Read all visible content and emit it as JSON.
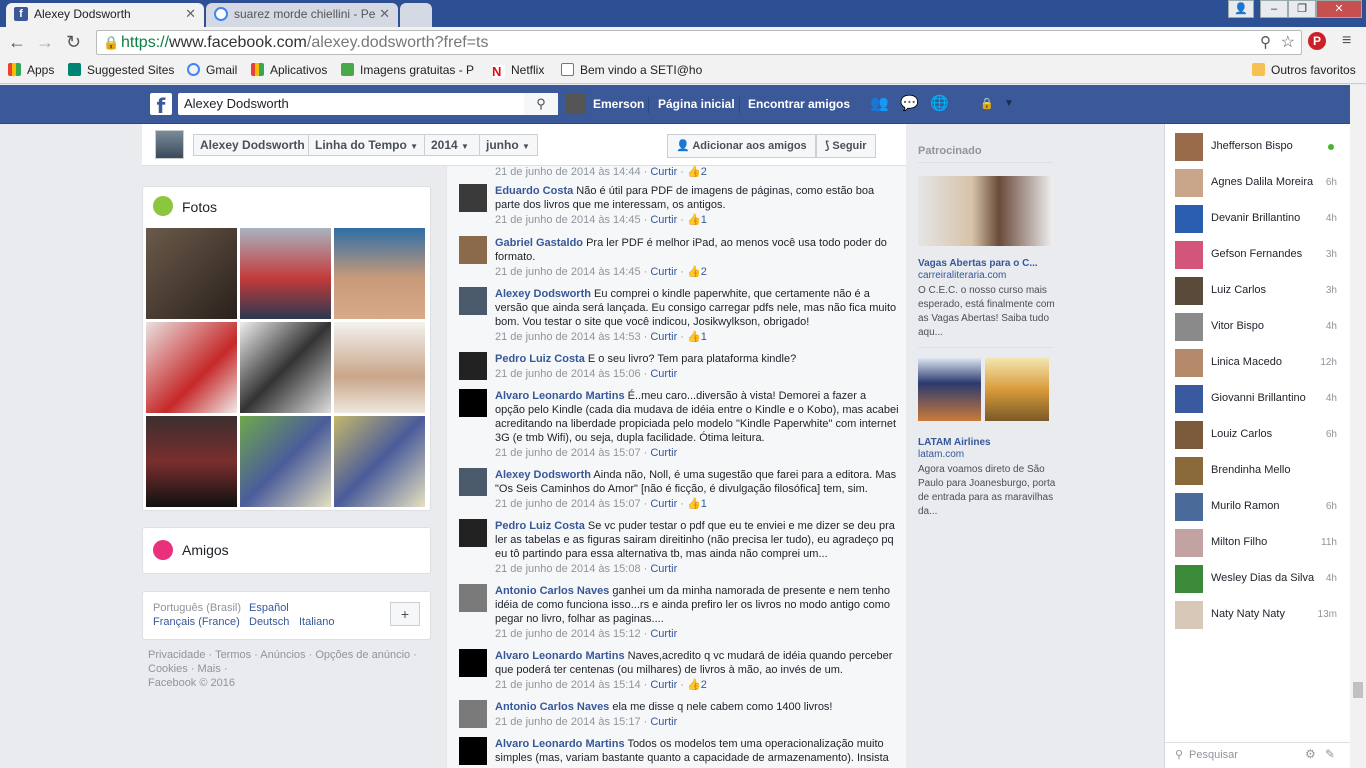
{
  "browser": {
    "tabs": [
      {
        "title": "Alexey Dodsworth",
        "favicon_color": "#3b5998"
      },
      {
        "title": "suarez morde chiellini - Pe",
        "favicon_color": "#4285f4"
      }
    ],
    "url_https": "https://",
    "url_host": "www.facebook.com",
    "url_path": "/alexey.dodsworth?fref=ts",
    "bookmarks": [
      "Apps",
      "Suggested Sites",
      "Gmail",
      "Aplicativos",
      "Imagens gratuitas - P",
      "Netflix",
      "Bem vindo a SETI@ho"
    ],
    "other_bookmarks": "Outros favoritos"
  },
  "fb": {
    "search_value": "Alexey Dodsworth",
    "user": "Emerson",
    "nav_home": "Página inicial",
    "nav_friends": "Encontrar amigos",
    "brand_color": "#3b5998"
  },
  "profile": {
    "name": "Alexey Dodsworth",
    "timeline": "Linha do Tempo",
    "year": "2014",
    "month": "junho",
    "add_friend": "Adicionar aos amigos",
    "follow": "Seguir"
  },
  "left": {
    "photos_title": "Fotos",
    "friends_title": "Amigos",
    "languages": [
      "Português (Brasil)",
      "Español",
      "Français (France)",
      "Deutsch",
      "Italiano"
    ],
    "footer_links": [
      "Privacidade",
      "Termos",
      "Anúncios",
      "Opções de anúncio",
      "Cookies",
      "Mais"
    ],
    "copyright": "Facebook © 2016"
  },
  "comments": [
    {
      "name": "",
      "text": "",
      "time": "21 de junho de 2014 às 14:44",
      "action": "Curtir",
      "likes": "2"
    },
    {
      "name": "Eduardo Costa",
      "text": "Não é útil para PDF de imagens de páginas, como estão boa parte dos livros que me interessam, os antigos.",
      "time": "21 de junho de 2014 às 14:45",
      "action": "Curtir",
      "likes": "1"
    },
    {
      "name": "Gabriel Gastaldo",
      "text": "Pra ler PDF é melhor iPad, ao menos você usa todo poder do formato.",
      "time": "21 de junho de 2014 às 14:45",
      "action": "Curtir",
      "likes": "2"
    },
    {
      "name": "Alexey Dodsworth",
      "text": "Eu comprei o kindle paperwhite, que certamente não é a versão que ainda será lançada. Eu consigo carregar pdfs nele, mas não fica muito bom. Vou testar o site que você indicou, Josikwylkson, obrigado!",
      "time": "21 de junho de 2014 às 14:53",
      "action": "Curtir",
      "likes": "1"
    },
    {
      "name": "Pedro Luiz Costa",
      "text": "E o seu livro? Tem para plataforma kindle?",
      "time": "21 de junho de 2014 às 15:06",
      "action": "Curtir",
      "likes": ""
    },
    {
      "name": "Alvaro Leonardo Martins",
      "text": "É..meu caro...diversão à vista! Demorei a fazer a opção pelo Kindle (cada dia mudava de idéia entre o Kindle e o Kobo), mas acabei acreditando na liberdade propiciada pelo modelo \"Kindle Paperwhite\" com internet 3G (e tmb Wifi), ou seja, dupla facilidade. Ótima leitura.",
      "time": "21 de junho de 2014 às 15:07",
      "action": "Curtir",
      "likes": ""
    },
    {
      "name": "Alexey Dodsworth",
      "text": "Ainda não, Noll, é uma sugestão que farei para a editora. Mas \"Os Seis Caminhos do Amor\" [não é ficção, é divulgação filosófica] tem, sim.",
      "time": "21 de junho de 2014 às 15:07",
      "action": "Curtir",
      "likes": "1"
    },
    {
      "name": "Pedro Luiz Costa",
      "text": "Se vc puder testar o pdf que eu te enviei e me dizer se deu pra ler as tabelas e as figuras sairam direitinho (não precisa ler tudo), eu agradeço pq eu tô partindo para essa alternativa tb, mas ainda não comprei um...",
      "time": "21 de junho de 2014 às 15:08",
      "action": "Curtir",
      "likes": ""
    },
    {
      "name": "Antonio Carlos Naves",
      "text": "ganhei um da minha namorada de presente e nem tenho idéia de como funciona isso...rs e ainda prefiro ler os livros no modo antigo como pegar no livro, folhar as paginas....",
      "time": "21 de junho de 2014 às 15:12",
      "action": "Curtir",
      "likes": ""
    },
    {
      "name": "Alvaro Leonardo Martins",
      "text": "Naves,acredito q vc mudará de idéia quando perceber que poderá ter centenas (ou milhares) de livros à mão, ao invés de um.",
      "time": "21 de junho de 2014 às 15:14",
      "action": "Curtir",
      "likes": "2"
    },
    {
      "name": "Antonio Carlos Naves",
      "text": "ela me disse q nele cabem como 1400 livros!",
      "time": "21 de junho de 2014 às 15:17",
      "action": "Curtir",
      "likes": ""
    },
    {
      "name": "Alvaro Leonardo Martins",
      "text": "Todos os modelos tem uma operacionalização muito simples (mas, variam bastante quanto a capacidade de armazenamento). Insista",
      "time": "",
      "action": "",
      "likes": ""
    }
  ],
  "ads": {
    "title": "Patrocinado",
    "ad1_title": "Vagas Abertas para o C...",
    "ad1_domain": "carreiraliteraria.com",
    "ad1_text": "O C.E.C. o nosso curso mais esperado, está finalmente com as Vagas Abertas! Saiba tudo aqu...",
    "ad2_title": "LATAM Airlines",
    "ad2_domain": "latam.com",
    "ad2_text": "Agora voamos direto de São Paulo para Joanesburgo, porta de entrada para as maravilhas da..."
  },
  "chat": {
    "contacts": [
      {
        "name": "Jhefferson Bispo",
        "time": "",
        "online": true
      },
      {
        "name": "Agnes Dalila Moreira",
        "time": "6h"
      },
      {
        "name": "Devanir Brillantino",
        "time": "4h"
      },
      {
        "name": "Gefson Fernandes",
        "time": "3h"
      },
      {
        "name": "Luiz Carlos",
        "time": "3h"
      },
      {
        "name": "Vitor Bispo",
        "time": "4h"
      },
      {
        "name": "Linica Macedo",
        "time": "12h"
      },
      {
        "name": "Giovanni Brillantino",
        "time": "4h"
      },
      {
        "name": "Louiz Carlos",
        "time": "6h"
      },
      {
        "name": "Brendinha Mello",
        "time": ""
      },
      {
        "name": "Murilo Ramon",
        "time": "6h"
      },
      {
        "name": "Milton Filho",
        "time": "11h"
      },
      {
        "name": "Wesley Dias da Silva",
        "time": "4h"
      },
      {
        "name": "Naty Naty Naty",
        "time": "13m"
      }
    ],
    "search_placeholder": "Pesquisar"
  }
}
